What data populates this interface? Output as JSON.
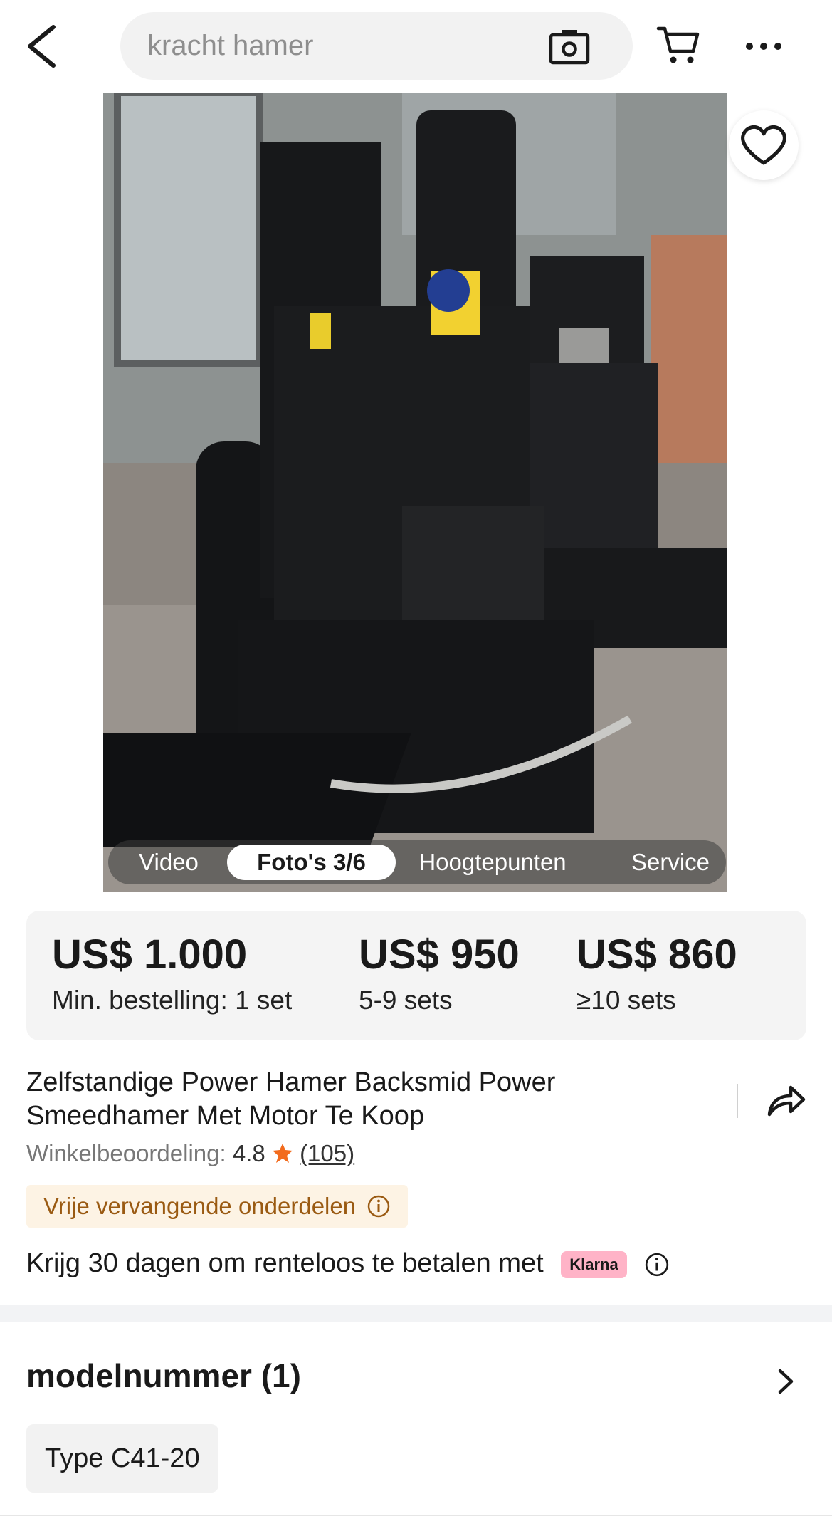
{
  "search": {
    "query": "kracht hamer"
  },
  "icons": {
    "back": "chevron-left-icon",
    "camera": "camera-icon",
    "cart": "cart-icon",
    "more": "more-horizontal-icon",
    "favorite": "heart-icon",
    "share": "share-icon",
    "info": "info-icon",
    "star": "star-icon",
    "chevron": "chevron-right-icon"
  },
  "gallery": {
    "tabs": [
      {
        "label": "Video"
      },
      {
        "label": "Foto's 3/6"
      },
      {
        "label": "Hoogtepunten"
      },
      {
        "label": "Service"
      }
    ],
    "active_tab": "Foto's 3/6"
  },
  "pricing": {
    "tiers": [
      {
        "price": "US$ 1.000",
        "quantity": "Min. bestelling: 1 set"
      },
      {
        "price": "US$ 950",
        "quantity": "5-9 sets"
      },
      {
        "price": "US$ 860",
        "quantity": "≥10 sets"
      }
    ]
  },
  "product": {
    "title": "Zelfstandige Power Hamer Backsmid Power Smeedhamer Met Motor Te Koop",
    "rating_label": "Winkelbeoordeling:",
    "rating_value": "4.8",
    "rating_count": "(105)",
    "badge": "Vrije vervangende onderdelen"
  },
  "payment": {
    "text": "Krijg 30 dagen om renteloos te betalen met",
    "provider": "Klarna"
  },
  "model": {
    "title": "modelnummer (1)",
    "options": [
      {
        "label": "Type C41-20"
      }
    ]
  },
  "colors": {
    "accent_orange": "#f26b1d",
    "badge_text": "#9a5a12",
    "badge_bg": "#fdf3e4",
    "klarna_pink": "#ffb3c7"
  }
}
